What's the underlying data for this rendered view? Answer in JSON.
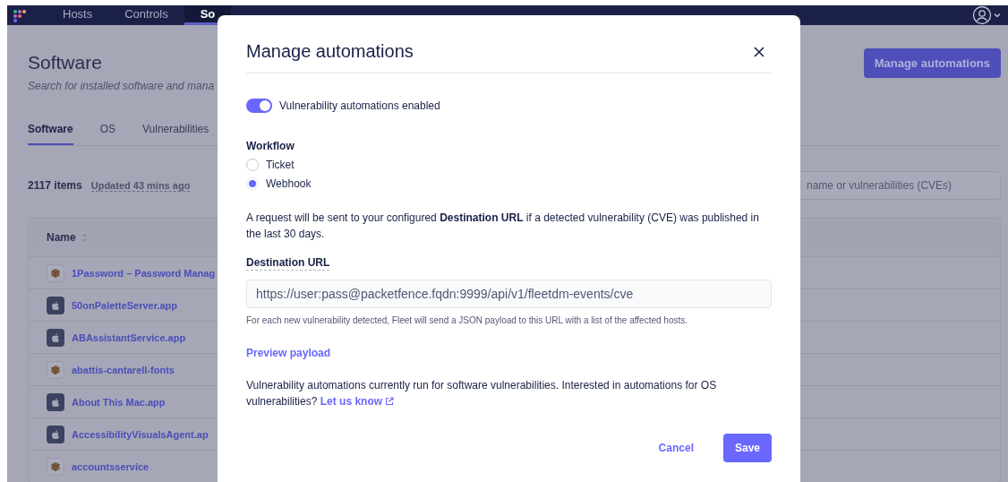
{
  "nav": {
    "items": [
      {
        "label": "Hosts",
        "selected": false
      },
      {
        "label": "Controls",
        "selected": false
      },
      {
        "label": "So",
        "selected": true
      }
    ]
  },
  "page": {
    "title": "Software",
    "subtitle": "Search for installed software and mana",
    "action_button": "Manage automations",
    "tabs": [
      {
        "label": "Software",
        "selected": true
      },
      {
        "label": "OS",
        "selected": false
      },
      {
        "label": "Vulnerabilities",
        "selected": false
      }
    ],
    "count": "2117 items",
    "updated": "Updated 43 mins ago",
    "search": {
      "placeholder": "name or vulnerabilities (CVEs)"
    },
    "table": {
      "columns": [
        "Name"
      ],
      "rows": [
        {
          "name": "1Password – Password Manag",
          "kind": "package"
        },
        {
          "name": "50onPaletteServer.app",
          "kind": "apple"
        },
        {
          "name": "ABAssistantService.app",
          "kind": "apple"
        },
        {
          "name": "abattis-cantarell-fonts",
          "kind": "package"
        },
        {
          "name": "About This Mac.app",
          "kind": "apple"
        },
        {
          "name": "AccessibilityVisualsAgent.ap",
          "kind": "apple"
        },
        {
          "name": "accountsservice",
          "kind": "package"
        }
      ]
    }
  },
  "modal": {
    "title": "Manage automations",
    "toggle": {
      "label": "Vulnerability automations enabled",
      "on": true
    },
    "workflow": {
      "label": "Workflow",
      "options": [
        {
          "label": "Ticket",
          "selected": false
        },
        {
          "label": "Webhook",
          "selected": true
        }
      ]
    },
    "description": "A request will be sent to your configured **Destination URL** if a detected vulnerability (CVE) was published in the last 30 days.",
    "url_field": {
      "label": "Destination URL",
      "value": "https://user:pass@packetfence.fqdn:9999/api/v1/fleetdm-events/cve",
      "help": "For each new vulnerability detected, Fleet will send a JSON payload to this URL with a list of the affected hosts."
    },
    "preview_link": "Preview payload",
    "note": "Vulnerability automations currently run for software vulnerabilities. Interested in automations for OS vulnerabilities?",
    "note_link": "Let us know",
    "buttons": [
      {
        "label": "Cancel",
        "kind": "secondary"
      },
      {
        "label": "Save",
        "kind": "primary"
      }
    ]
  }
}
